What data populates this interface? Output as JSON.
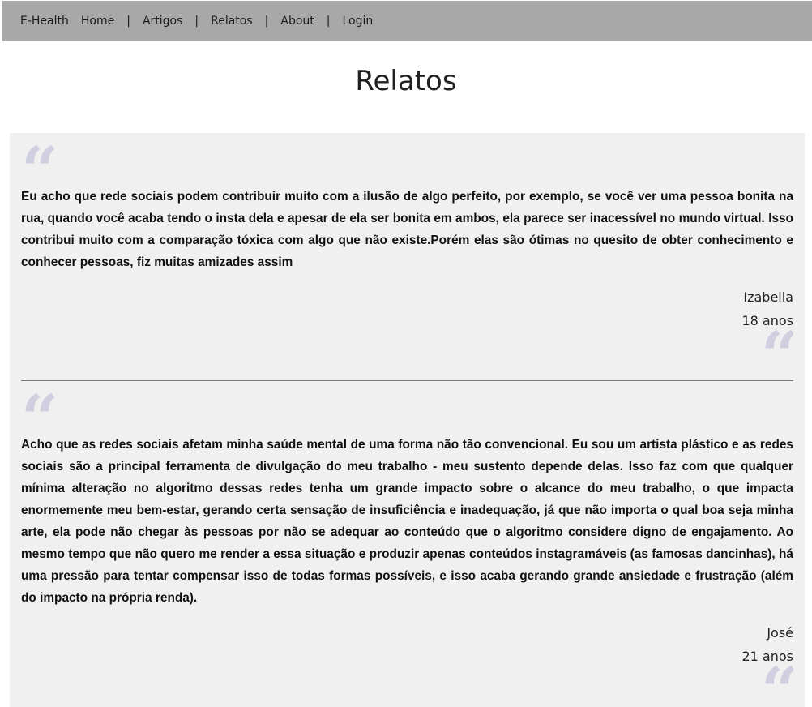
{
  "nav": {
    "brand": "E-Health",
    "items": [
      "Home",
      "Artigos",
      "Relatos",
      "About",
      "Login"
    ],
    "separator": "|"
  },
  "page": {
    "title": "Relatos"
  },
  "testimonials": [
    {
      "text": "Eu acho que rede sociais podem contribuir muito com a ilusão de algo perfeito, por exemplo, se você ver uma pessoa bonita na rua, quando você acaba tendo o insta dela e apesar de ela ser bonita em ambos, ela parece ser inacessível no mundo virtual. Isso contribui muito com a comparação tóxica com algo que não existe.Porém elas são ótimas no quesito de obter conhecimento e conhecer pessoas, fiz muitas amizades assim",
      "author": "Izabella",
      "age": "18 anos"
    },
    {
      "text": "Acho que as redes sociais afetam minha saúde mental de uma forma não tão convencional. Eu sou um artista plástico e as redes sociais são a principal ferramenta de divulgação do meu trabalho - meu sustento depende delas. Isso faz com que qualquer mínima alteração no algoritmo dessas redes tenha um grande impacto sobre o alcance do meu trabalho, o que impacta enormemente meu bem-estar, gerando certa sensação de insuficiência e inadequação, já que não importa o qual boa seja minha arte, ela pode não chegar às pessoas por não se adequar ao conteúdo que o algoritmo considere digno de engajamento. Ao mesmo tempo que não quero me render a essa situação e produzir apenas conteúdos instagramáveis (as famosas dancinhas), há uma pressão para tentar compensar isso de todas formas possíveis, e isso acaba gerando grande ansiedade e frustração (além do impacto na própria renda).",
      "author": "José",
      "age": "21 anos"
    }
  ],
  "colors": {
    "navbar_bg": "#a8a8a8",
    "card_bg": "#f0f0f0",
    "quote_mark": "#cfcfe0"
  },
  "icons": {
    "quote": "quote-mark-icon"
  }
}
